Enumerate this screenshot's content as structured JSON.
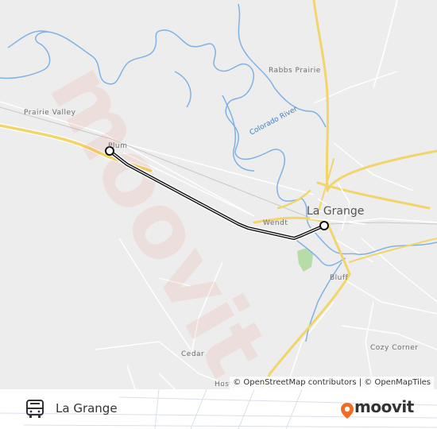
{
  "map": {
    "labels": {
      "prairie_valley": "Prairie Valley",
      "rabbs_prairie": "Rabbs Prairie",
      "colorado_river": "Colorado River",
      "plum": "Plum",
      "wendt": "Wendt",
      "la_grange": "La Grange",
      "bluff": "Bluff",
      "cedar": "Cedar",
      "cozy_corner": "Cozy Corner",
      "hosty": "Hosty"
    },
    "attribution": "© OpenStreetMap contributors | © OpenMapTiles",
    "watermark": "moovit",
    "colors": {
      "background": "#ededed",
      "river": "#7fb2e6",
      "highway": "#f2d56a",
      "road": "#ffffff",
      "route": "#111111",
      "park": "#b7dca8"
    }
  },
  "route": {
    "name": "La Grange",
    "icon": "bus-icon",
    "stops": [
      "Plum",
      "La Grange"
    ]
  },
  "branding": {
    "logo": "moovit",
    "accent": "#f26b21"
  }
}
